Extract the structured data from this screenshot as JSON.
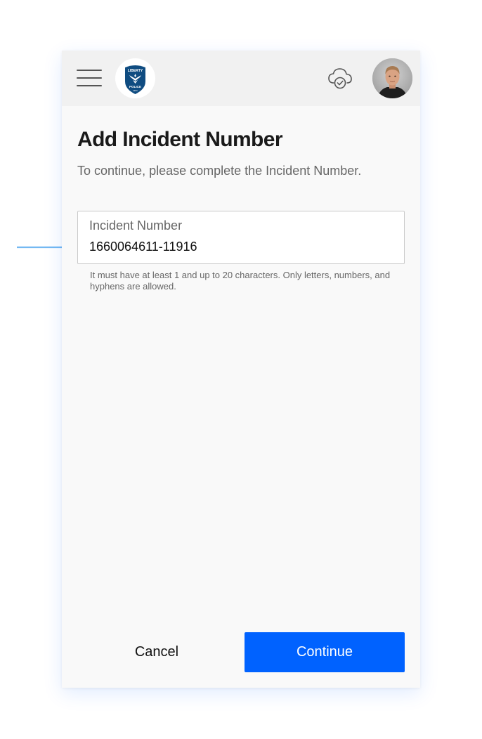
{
  "header": {
    "menu_icon": "hamburger-menu-icon",
    "logo": {
      "text_top": "LIBERTY",
      "text_bottom": "POLICE",
      "text_small": "DPD",
      "icon": "police-badge-logo",
      "color": "#0f4c81"
    },
    "sync_icon": "cloud-check-icon",
    "avatar_icon": "user-avatar"
  },
  "main": {
    "title": "Add Incident Number",
    "subtitle": "To continue, please complete the Incident Number.",
    "incident_field": {
      "label": "Incident Number",
      "value": "1660064611-11916"
    },
    "helper_text": "It must have at least 1 and up to 20 characters. Only letters, numbers, and hyphens are allowed."
  },
  "footer": {
    "cancel_label": "Cancel",
    "continue_label": "Continue"
  },
  "colors": {
    "accent": "#0062ff",
    "arrow": "#74b9f2",
    "header_bg": "#f1f1f1",
    "page_bg": "#f9f9f9"
  },
  "annotation": {
    "icon": "pointer-arrow-icon"
  }
}
